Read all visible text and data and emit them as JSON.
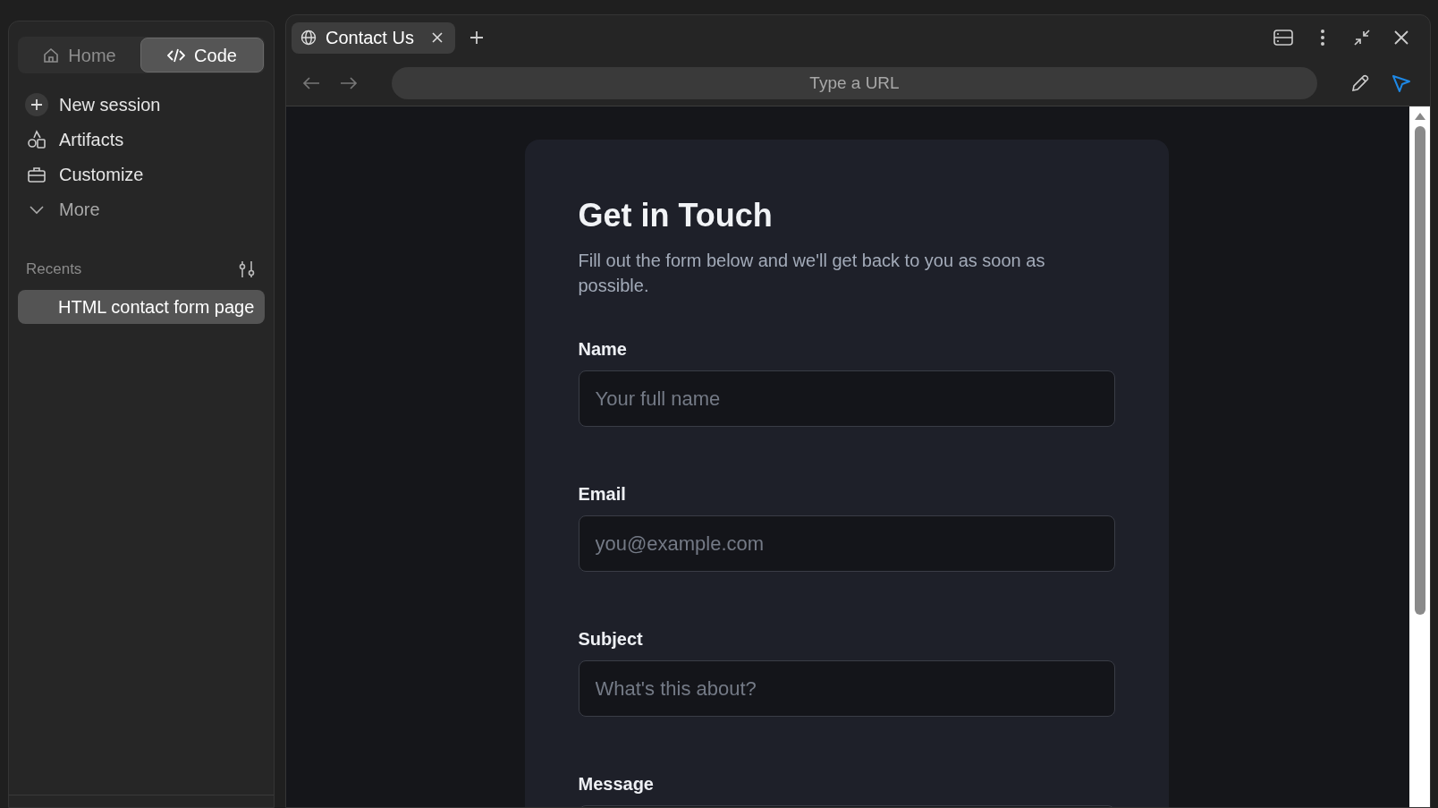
{
  "sidebar": {
    "modes": [
      {
        "label": "Home",
        "selected": false
      },
      {
        "label": "Code",
        "selected": true
      }
    ],
    "nav": [
      {
        "label": "New session"
      },
      {
        "label": "Artifacts"
      },
      {
        "label": "Customize"
      },
      {
        "label": "More"
      }
    ],
    "recents": {
      "title": "Recents",
      "items": [
        {
          "label": "HTML contact form page",
          "selected": true
        }
      ]
    }
  },
  "browser": {
    "tabs": [
      {
        "label": "Contact Us",
        "selected": true
      }
    ],
    "address_bar": {
      "placeholder": "Type a URL"
    },
    "page": {
      "heading": "Get in Touch",
      "intro": "Fill out the form below and we'll get back to you as soon as possible.",
      "fields": [
        {
          "kind": "input",
          "label": "Name",
          "placeholder": "Your full name"
        },
        {
          "kind": "input",
          "label": "Email",
          "placeholder": "you@example.com"
        },
        {
          "kind": "input",
          "label": "Subject",
          "placeholder": "What's this about?"
        },
        {
          "kind": "textarea",
          "label": "Message"
        }
      ]
    }
  }
}
